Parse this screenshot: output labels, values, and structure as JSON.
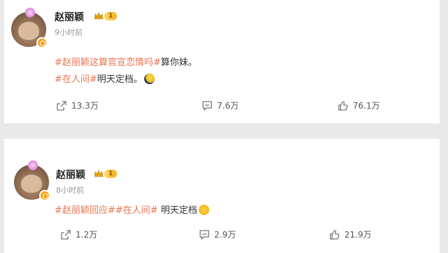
{
  "colors": {
    "hashtag": "#eb7350",
    "level_badge": "#f7b21a",
    "verified": "#f7a11a"
  },
  "posts": [
    {
      "author": "赵丽颖",
      "level": "1",
      "time": "9小时前",
      "lines": [
        {
          "tag": "#赵丽颖这算官宣恋情吗#",
          "text": "算你妹。",
          "emoji": ""
        },
        {
          "tag": "#在人间#",
          "text": "明天定档。",
          "emoji": "moon-emoji"
        }
      ],
      "stats": {
        "share": "13.3万",
        "comment": "7.6万",
        "like": "76.1万"
      }
    },
    {
      "author": "赵丽颖",
      "level": "1",
      "time": "8小时前",
      "lines": [
        {
          "tag": "#赵丽颖回应##在人间#",
          "text": "明天定档",
          "emoji": "tears-emoji"
        }
      ],
      "stats": {
        "share": "1.2万",
        "comment": "2.9万",
        "like": "21.9万"
      }
    }
  ],
  "icons": {
    "share": "share-icon",
    "comment": "comment-icon",
    "like": "like-icon",
    "crown": "crown-icon"
  }
}
